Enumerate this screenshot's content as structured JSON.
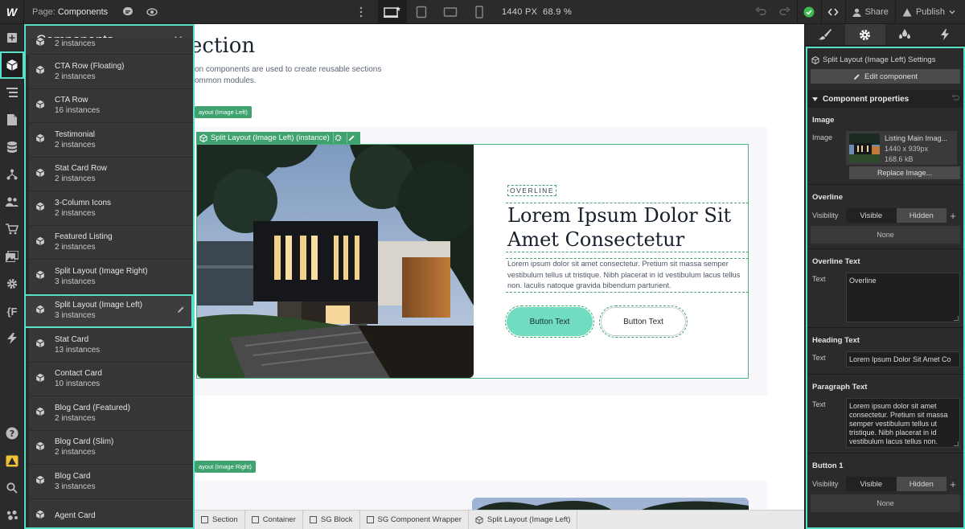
{
  "topbar": {
    "logo": "W",
    "page_label": "Page:",
    "page_name": "Components",
    "canvas_size": "1440 PX",
    "zoom": "68.9 %",
    "share_label": "Share",
    "publish_label": "Publish"
  },
  "components_panel": {
    "title": "Components",
    "items": [
      {
        "name": "",
        "count": "2 instances"
      },
      {
        "name": "CTA Row (Floating)",
        "count": "2 instances"
      },
      {
        "name": "CTA Row",
        "count": "16 instances"
      },
      {
        "name": "Testimonial",
        "count": "2 instances"
      },
      {
        "name": "Stat Card Row",
        "count": "2 instances"
      },
      {
        "name": "3-Column Icons",
        "count": "2 instances"
      },
      {
        "name": "Featured Listing",
        "count": "2 instances"
      },
      {
        "name": "Split Layout (Image Right)",
        "count": "3 instances"
      },
      {
        "name": "Split Layout (Image Left)",
        "count": "3 instances"
      },
      {
        "name": "Stat Card",
        "count": "13 instances"
      },
      {
        "name": "Contact Card",
        "count": "10 instances"
      },
      {
        "name": "Blog Card (Featured)",
        "count": "2 instances"
      },
      {
        "name": "Blog Card (Slim)",
        "count": "2 instances"
      },
      {
        "name": "Blog Card",
        "count": "3 instances"
      },
      {
        "name": "Agent Card",
        "count": ""
      }
    ]
  },
  "canvas": {
    "section_title": "ection",
    "section_desc": "on components are used to create reusable sections ommon modules.",
    "tag_top": "ayout (Image Left)",
    "instance_tag": "Split Layout (Image Left) (instance)",
    "overline": "OVERLINE",
    "heading": "Lorem Ipsum Dolor Sit Amet Consectetur",
    "paragraph": "Lorem ipsum dolor sit amet consectetur. Pretium sit massa semper vestibulum tellus ut tristique. Nibh placerat in id vestibulum lacus tellus non. laculis natoque gravida bibendum parturient.",
    "button1": "Button Text",
    "button2": "Button Text",
    "tag_bottom": "ayout (Image Right)"
  },
  "breadcrumb": [
    {
      "label": "Section"
    },
    {
      "label": "Container"
    },
    {
      "label": "SG Block"
    },
    {
      "label": "SG Component Wrapper"
    },
    {
      "label": "Split Layout (Image Left)"
    }
  ],
  "right_panel": {
    "settings_title": "Split Layout (Image Left) Settings",
    "edit_component": "Edit component",
    "component_properties": "Component properties",
    "image_section": {
      "title": "Image",
      "label": "Image",
      "file_name": "Listing Main Imag...",
      "dimensions": "1440 x 939px",
      "file_size": "168.6 kB",
      "replace": "Replace Image..."
    },
    "overline_section": {
      "title": "Overline",
      "label": "Visibility",
      "visible": "Visible",
      "hidden": "Hidden",
      "none": "None"
    },
    "overline_text_section": {
      "title": "Overline Text",
      "label": "Text",
      "value": "Overline"
    },
    "heading_text_section": {
      "title": "Heading Text",
      "label": "Text",
      "value": "Lorem Ipsum Dolor Sit Amet Co"
    },
    "paragraph_text_section": {
      "title": "Paragraph Text",
      "label": "Text",
      "value": "Lorem ipsum dolor sit amet consectetur. Pretium sit massa semper vestibulum tellus ut tristique. Nibh placerat in id vestibulum lacus tellus non. laculis natoque"
    },
    "button1_section": {
      "title": "Button 1",
      "label": "Visibility",
      "visible": "Visible",
      "hidden": "Hidden",
      "none": "None"
    }
  },
  "colors": {
    "highlight": "#5be0c8",
    "instance_green": "#3fa26f",
    "primary_button": "#72dcc1",
    "ui_dark": "#2b2b2b"
  },
  "icons": [
    "add-icon",
    "components-icon",
    "navigator-icon",
    "pages-icon",
    "cms-icon",
    "logic-icon",
    "users-icon",
    "ecommerce-icon",
    "assets-icon",
    "settings-icon",
    "variables-icon",
    "apps-icon",
    "help-icon",
    "audit-icon",
    "search-icon",
    "collaborators-icon",
    "comment-icon",
    "eye-icon",
    "more-icon",
    "desktop-star-icon",
    "tablet-icon",
    "mobile-landscape-icon",
    "mobile-icon",
    "undo-icon",
    "redo-icon",
    "check-icon",
    "code-icon",
    "user-icon",
    "publish-icon",
    "style-brush-icon",
    "gear-icon",
    "drops-icon",
    "bolt-icon",
    "cube-icon",
    "pencil-icon",
    "close-icon"
  ]
}
